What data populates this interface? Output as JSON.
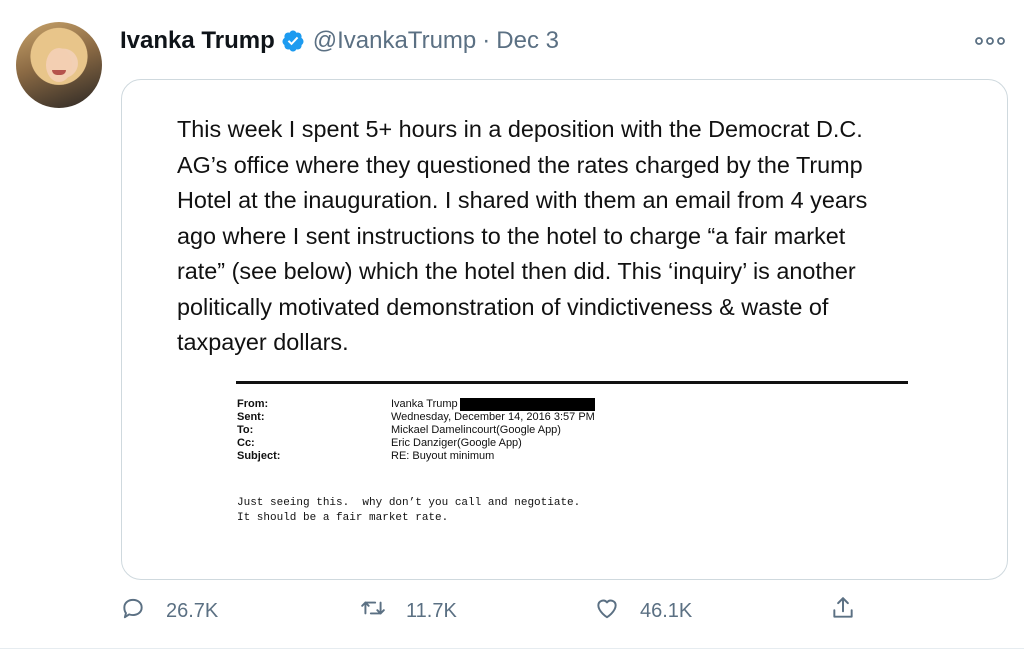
{
  "tweet": {
    "author_name": "Ivanka Trump",
    "handle": "@IvankaTrump",
    "separator": "·",
    "date": "Dec 3",
    "more_icon": "more-horizontal-icon",
    "verified_icon": "verified-badge-icon"
  },
  "media": {
    "statement_lines": [
      "This week I spent 5+ hours in a deposition with the Democrat D.C.",
      "AG’s office where they questioned the rates charged by the Trump",
      "Hotel at the inauguration. I shared with them an email from 4 years",
      "ago where I sent instructions to the hotel to charge “a fair market",
      "rate” (see below) which the hotel then did.  This ‘inquiry’ is another",
      "politically motivated demonstration of vindictiveness & waste of",
      "taxpayer dollars."
    ],
    "email": {
      "from_label": "From:",
      "from_value": "Ivanka Trump",
      "sent_label": "Sent:",
      "sent_value": "Wednesday, December 14, 2016 3:57 PM",
      "to_label": "To:",
      "to_value": "Mickael Damelincourt(Google App)",
      "cc_label": "Cc:",
      "cc_value": "Eric Danziger(Google App)",
      "subject_label": "Subject:",
      "subject_value": "RE: Buyout minimum",
      "body_line1": "Just seeing this.  why don’t you call and negotiate.",
      "body_line2": "It should be a fair market rate."
    }
  },
  "actions": {
    "reply_count": "26.7K",
    "retweet_count": "11.7K",
    "like_count": "46.1K"
  }
}
